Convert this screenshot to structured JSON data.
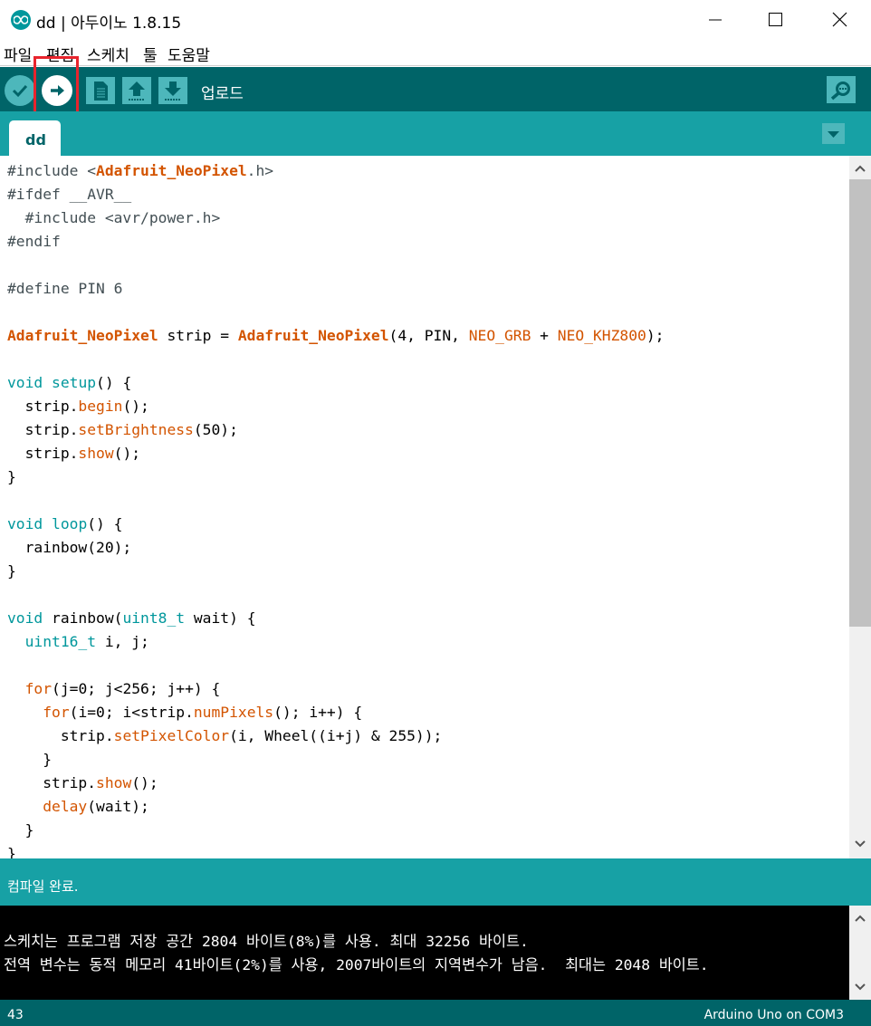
{
  "window": {
    "title": "dd | 아두이노 1.8.15"
  },
  "menu": [
    "파일",
    "편집",
    "스케치",
    "툴",
    "도움말"
  ],
  "toolbar": {
    "hover_label": "업로드",
    "buttons": [
      "verify-icon",
      "upload-icon",
      "new-icon",
      "open-icon",
      "save-icon",
      "serial-monitor-icon"
    ]
  },
  "tabs": [
    "dd"
  ],
  "colors": {
    "toolbar": "#006468",
    "tabbar": "#17A1A5",
    "highlight": "#e8242d"
  },
  "code_lines": [
    [
      {
        "t": "#include <",
        "c": "pp"
      },
      {
        "t": "Adafruit_NeoPixel",
        "c": "lib"
      },
      {
        "t": ".h>",
        "c": "pp"
      }
    ],
    [
      {
        "t": "#ifdef __AVR__",
        "c": "pp"
      }
    ],
    [
      {
        "t": "  #include <avr/power.h>",
        "c": "pp"
      }
    ],
    [
      {
        "t": "#endif",
        "c": "pp"
      }
    ],
    [],
    [
      {
        "t": "#define PIN 6",
        "c": "pp"
      }
    ],
    [],
    [
      {
        "t": "Adafruit_NeoPixel",
        "c": "lib"
      },
      {
        "t": " strip = "
      },
      {
        "t": "Adafruit_NeoPixel",
        "c": "lib"
      },
      {
        "t": "(4, PIN, "
      },
      {
        "t": "NEO_GRB",
        "c": "fn"
      },
      {
        "t": " + "
      },
      {
        "t": "NEO_KHZ800",
        "c": "fn"
      },
      {
        "t": ");"
      }
    ],
    [],
    [
      {
        "t": "void",
        "c": "kw"
      },
      {
        "t": " "
      },
      {
        "t": "setup",
        "c": "kw"
      },
      {
        "t": "() {"
      }
    ],
    [
      {
        "t": "  strip."
      },
      {
        "t": "begin",
        "c": "fn"
      },
      {
        "t": "();"
      }
    ],
    [
      {
        "t": "  strip."
      },
      {
        "t": "setBrightness",
        "c": "fn"
      },
      {
        "t": "(50);"
      }
    ],
    [
      {
        "t": "  strip."
      },
      {
        "t": "show",
        "c": "fn"
      },
      {
        "t": "();"
      }
    ],
    [
      {
        "t": "}"
      }
    ],
    [],
    [
      {
        "t": "void",
        "c": "kw"
      },
      {
        "t": " "
      },
      {
        "t": "loop",
        "c": "kw"
      },
      {
        "t": "() {"
      }
    ],
    [
      {
        "t": "  rainbow(20);"
      }
    ],
    [
      {
        "t": "}"
      }
    ],
    [],
    [
      {
        "t": "void",
        "c": "kw"
      },
      {
        "t": " rainbow("
      },
      {
        "t": "uint8_t",
        "c": "kw"
      },
      {
        "t": " wait) {"
      }
    ],
    [
      {
        "t": "  "
      },
      {
        "t": "uint16_t",
        "c": "kw"
      },
      {
        "t": " i, j;"
      }
    ],
    [],
    [
      {
        "t": "  "
      },
      {
        "t": "for",
        "c": "fn"
      },
      {
        "t": "(j=0; j<256; j++) {"
      }
    ],
    [
      {
        "t": "    "
      },
      {
        "t": "for",
        "c": "fn"
      },
      {
        "t": "(i=0; i<strip."
      },
      {
        "t": "numPixels",
        "c": "fn"
      },
      {
        "t": "(); i++) {"
      }
    ],
    [
      {
        "t": "      strip."
      },
      {
        "t": "setPixelColor",
        "c": "fn"
      },
      {
        "t": "(i, Wheel((i+j) & 255));"
      }
    ],
    [
      {
        "t": "    }"
      }
    ],
    [
      {
        "t": "    strip."
      },
      {
        "t": "show",
        "c": "fn"
      },
      {
        "t": "();"
      }
    ],
    [
      {
        "t": "    "
      },
      {
        "t": "delay",
        "c": "fn"
      },
      {
        "t": "(wait);"
      }
    ],
    [
      {
        "t": "  }"
      }
    ],
    [
      {
        "t": "}"
      }
    ]
  ],
  "status": {
    "message": "컴파일 완료."
  },
  "console": {
    "lines": [
      "스케치는 프로그램 저장 공간 2804 바이트(8%)를 사용. 최대 32256 바이트.",
      "전역 변수는 동적 메모리 41바이트(2%)를 사용, 2007바이트의 지역변수가 남음.  최대는 2048 바이트."
    ]
  },
  "footer": {
    "line_number": "43",
    "board": "Arduino Uno on COM3"
  }
}
